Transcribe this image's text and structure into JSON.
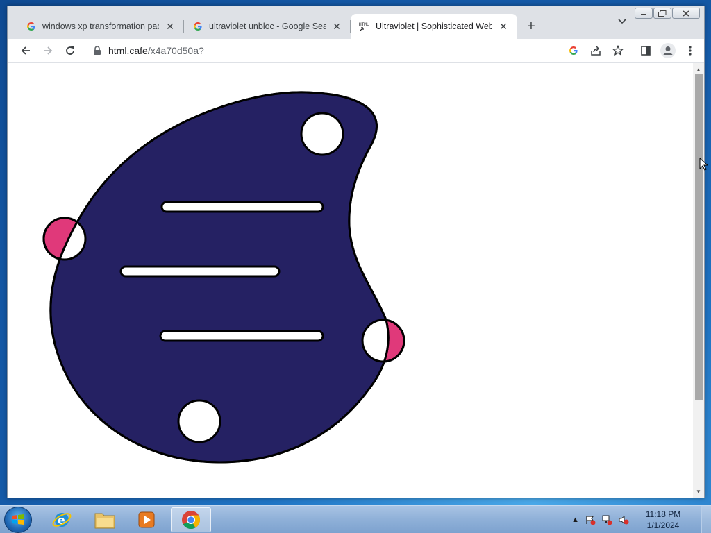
{
  "browser": {
    "tabs": [
      {
        "title": "windows xp transformation pack",
        "favicon": "google-g-icon",
        "active": false
      },
      {
        "title": "ultraviolet unbloc - Google Searc",
        "favicon": "google-g-icon",
        "active": false
      },
      {
        "title": "Ultraviolet | Sophisticated Web P",
        "favicon": "html-icon",
        "active": true
      }
    ],
    "new_tab_label": "+",
    "url_host": "html.cafe",
    "url_path": "/x4a70d50a?"
  },
  "page": {
    "blob_color": "#252163",
    "accent_color": "#e0397a",
    "outline_color": "#000000"
  },
  "taskbar": {
    "apps": [
      "start-orb",
      "internet-explorer",
      "windows-explorer",
      "media-player",
      "chrome"
    ],
    "active_app": "chrome",
    "time": "11:18 PM",
    "date": "1/1/2024"
  }
}
